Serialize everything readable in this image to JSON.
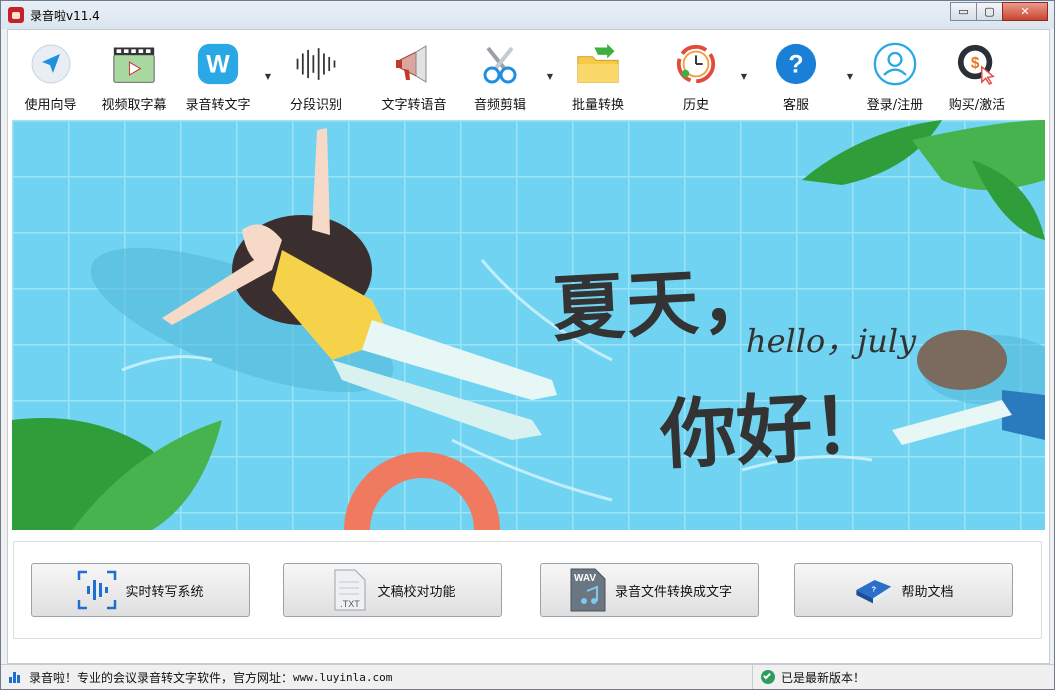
{
  "window": {
    "title": "录音啦v11.4",
    "controls": {
      "minimize": "▭",
      "maximize": "▢",
      "close": "✕"
    }
  },
  "toolbar": {
    "items": [
      {
        "label": "使用向导",
        "icon": "navigate-arrow-icon",
        "has_dropdown": false
      },
      {
        "label": "视频取字幕",
        "icon": "video-subtitle-icon",
        "has_dropdown": false
      },
      {
        "label": "录音转文字",
        "icon": "w-logo-icon",
        "has_dropdown": true
      },
      {
        "label": "分段识别",
        "icon": "waveform-icon",
        "has_dropdown": false
      },
      {
        "label": "文字转语音",
        "icon": "megaphone-icon",
        "has_dropdown": false
      },
      {
        "label": "音频剪辑",
        "icon": "scissors-icon",
        "has_dropdown": true
      },
      {
        "label": "批量转换",
        "icon": "folder-convert-icon",
        "has_dropdown": false
      },
      {
        "label": "历史",
        "icon": "history-clock-icon",
        "has_dropdown": true
      },
      {
        "label": "客服",
        "icon": "help-question-icon",
        "has_dropdown": true
      },
      {
        "label": "登录/注册",
        "icon": "user-login-icon",
        "has_dropdown": false
      },
      {
        "label": "购买/激活",
        "icon": "buy-activate-icon",
        "has_dropdown": false
      }
    ],
    "dropdown_glyph": "▼"
  },
  "banner": {
    "line1": "夏天，",
    "line2": "hello，july",
    "line3": "你好！"
  },
  "actions": [
    {
      "label": "实时转写系统",
      "icon": "realtime-wave-icon"
    },
    {
      "label": "文稿校对功能",
      "icon": "txt-document-icon"
    },
    {
      "label": "录音文件转换成文字",
      "icon": "wav-file-icon"
    },
    {
      "label": "帮助文档",
      "icon": "help-book-icon"
    }
  ],
  "status": {
    "left_text": "录音啦！专业的会议录音转文字软件，官方网址：",
    "url": "www.luyinla.com",
    "right_text": "已是最新版本！"
  },
  "colors": {
    "banner_sky": "#6fd3f1",
    "leaf_green": "#2f9e3a",
    "accent_blue": "#1f8fe0",
    "ring_coral": "#f07a5f"
  }
}
